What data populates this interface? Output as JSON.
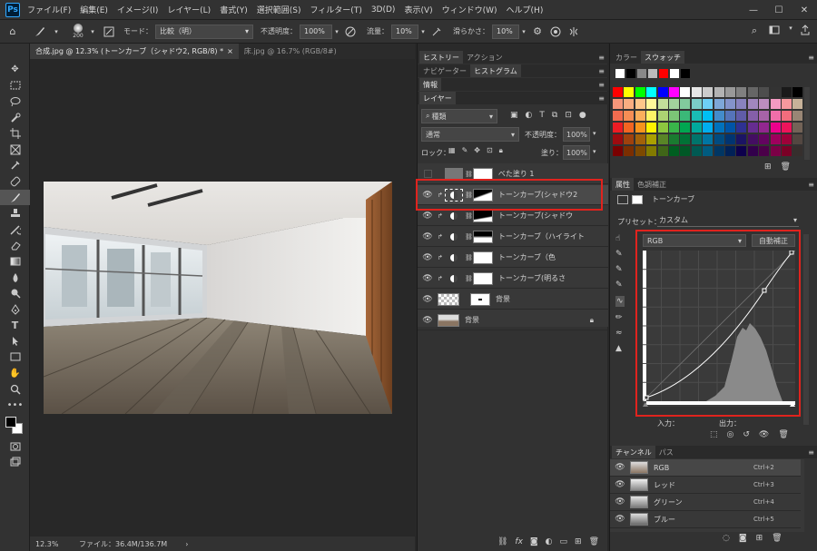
{
  "menu": {
    "logo": "Ps",
    "items": [
      "ファイル(F)",
      "編集(E)",
      "イメージ(I)",
      "レイヤー(L)",
      "書式(Y)",
      "選択範囲(S)",
      "フィルター(T)",
      "3D(D)",
      "表示(V)",
      "ウィンドウ(W)",
      "ヘルプ(H)"
    ],
    "minimize": "—",
    "maximize": "☐",
    "close": "✕"
  },
  "options": {
    "brush_size": "200",
    "mode_label": "モード：",
    "mode_value": "比較（明）",
    "opacity_label": "不透明度：",
    "opacity_value": "100%",
    "flow_label": "流量：",
    "flow_value": "10%",
    "smooth_label": "滑らかさ：",
    "smooth_value": "10%"
  },
  "doc": {
    "tab_active": "合成.jpg @ 12.3% (トーンカーブ（シャドウ2, RGB/8) *",
    "tab_close": "×",
    "tab_inactive": "床.jpg @ 16.7% (RGB/8#)",
    "zoom": "12.3%",
    "file_info": "ファイル：36.4M/136.7M",
    "arrow": "›"
  },
  "mid": {
    "tabs1": [
      "ヒストリー",
      "アクション"
    ],
    "tabs2": [
      "ナビゲーター",
      "ヒストグラム"
    ],
    "info_tab": "情報",
    "layers_tab": "レイヤー",
    "kind_value": "種類",
    "blend_value": "通常",
    "opacity_label": "不透明度：",
    "opacity_value": "100%",
    "lock_label": "ロック：",
    "fill_label": "塗り：",
    "fill_value": "100%",
    "layers": [
      {
        "name": "べた塗り 1"
      },
      {
        "name": "トーンカーブ(シャドウ2"
      },
      {
        "name": "トーンカーブ(シャドウ"
      },
      {
        "name": "トーンカーブ（ハイライト"
      },
      {
        "name": "トーンカーブ（色"
      },
      {
        "name": "トーンカーブ(明るさ"
      },
      {
        "name": "背景"
      },
      {
        "name": "背景"
      }
    ]
  },
  "right": {
    "color_tab": "カラー",
    "swatches_tab": "スウォッチ",
    "props_tab": "属性",
    "adjust_tab": "色調補正",
    "curve_title": "トーンカーブ",
    "preset_label": "プリセット：",
    "preset_value": "カスタム",
    "channel_value": "RGB",
    "auto_button": "自動補正",
    "input_label": "入力：",
    "output_label": "出力：",
    "channels_tab": "チャンネル",
    "paths_tab": "パス",
    "channels": [
      {
        "name": "RGB",
        "shortcut": "Ctrl+2"
      },
      {
        "name": "レッド",
        "shortcut": "Ctrl+3"
      },
      {
        "name": "グリーン",
        "shortcut": "Ctrl+4"
      },
      {
        "name": "ブルー",
        "shortcut": "Ctrl+5"
      }
    ]
  },
  "colors": {
    "highlight": "#e0231e"
  }
}
